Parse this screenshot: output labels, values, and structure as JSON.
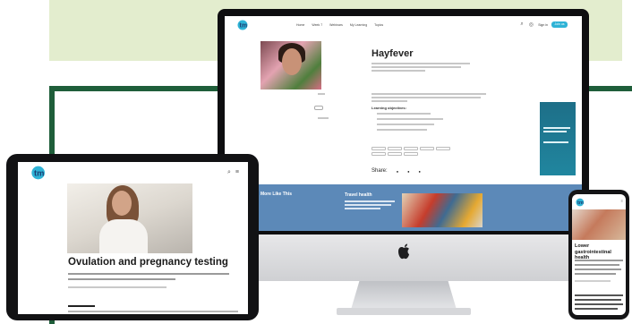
{
  "desktop": {
    "nav": {
      "items": [
        "Home",
        "Week 7",
        "Webinars",
        "My Learning",
        "Topics"
      ],
      "sign_in": "Sign in",
      "join": "Join us"
    },
    "article": {
      "title": "Hayfever",
      "learning_objectives_heading": "Learning objectives:",
      "share_label": "Share:"
    },
    "related": {
      "band_title": "More Like This",
      "card_title": "Travel health"
    }
  },
  "tablet": {
    "article": {
      "title": "Ovulation and pregnancy testing"
    }
  },
  "phone": {
    "article": {
      "title": "Lower gastrointestinal health"
    }
  },
  "colors": {
    "brand_teal": "#2fb3d6",
    "brand_navy": "#1c3f73",
    "frame_green": "#1f5e3a",
    "banner_green": "#e3edce",
    "related_band": "#5c89b8"
  }
}
